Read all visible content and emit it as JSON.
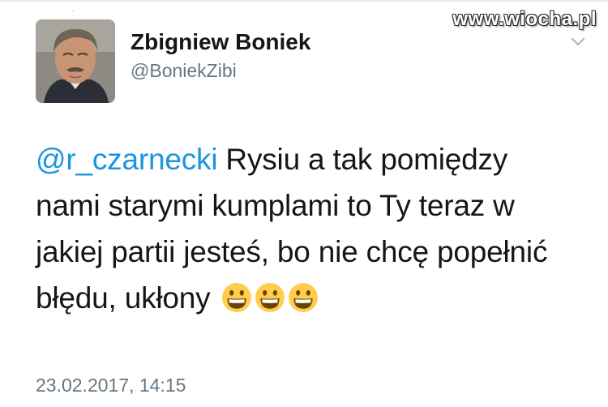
{
  "watermark": "www.wiocha.pl",
  "author": {
    "name": "Zbigniew Boniek",
    "handle": "@BoniekZibi"
  },
  "tweet": {
    "mention": "@r_czarnecki",
    "line1_rest": " Rysiu a tak pomiędzy",
    "line2": "nami starymi kumplami to Ty teraz w",
    "line3": "jakiej partii jesteś, bo nie chcę popełnić",
    "line4": "błędu, ukłony",
    "emojis": [
      "grinning-face-icon",
      "grinning-face-icon",
      "grinning-face-icon"
    ]
  },
  "timestamp": "23.02.2017, 14:15",
  "colors": {
    "mention": "#1b95e0",
    "text": "#14171a",
    "secondary": "#657786"
  }
}
